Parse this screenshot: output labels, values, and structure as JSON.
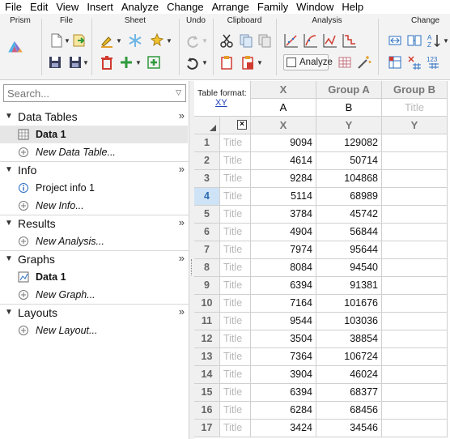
{
  "menu": [
    "File",
    "Edit",
    "View",
    "Insert",
    "Analyze",
    "Change",
    "Arrange",
    "Family",
    "Window",
    "Help"
  ],
  "ribbon": {
    "groups": {
      "prism": "Prism",
      "file": "File",
      "sheet": "Sheet",
      "undo": "Undo",
      "clipboard": "Clipboard",
      "analysis": "Analysis",
      "change": "Change"
    },
    "analyze_label": "Analyze",
    "colors": {
      "accent_red": "#d03a2f",
      "accent_green": "#2f9a3c",
      "accent_blue": "#2b6fc2",
      "accent_orange": "#e4a02a"
    }
  },
  "navigator": {
    "search_placeholder": "Search...",
    "sections": [
      {
        "label": "Data Tables",
        "items": [
          {
            "label": "Data 1",
            "icon": "data-table-icon"
          },
          {
            "label": "New Data Table...",
            "icon": "plus-circle-icon"
          }
        ]
      },
      {
        "label": "Info",
        "items": [
          {
            "label": "Project info 1",
            "icon": "info-icon"
          },
          {
            "label": "New Info...",
            "icon": "plus-circle-icon"
          }
        ]
      },
      {
        "label": "Results",
        "items": [
          {
            "label": "New Analysis...",
            "icon": "plus-circle-icon"
          }
        ]
      },
      {
        "label": "Graphs",
        "items": [
          {
            "label": "Data 1",
            "icon": "graph-icon"
          },
          {
            "label": "New Graph...",
            "icon": "plus-circle-icon"
          }
        ]
      },
      {
        "label": "Layouts",
        "items": [
          {
            "label": "New Layout...",
            "icon": "plus-circle-icon"
          }
        ]
      }
    ]
  },
  "sheet": {
    "table_format_label": "Table format:",
    "table_format_value": "XY",
    "columns": [
      {
        "header": "X",
        "title": "A",
        "sub": "X"
      },
      {
        "header": "Group A",
        "title": "B",
        "sub": "Y"
      },
      {
        "header": "Group B",
        "title": "Title",
        "sub": "Y"
      }
    ],
    "title_placeholder": "Title",
    "current_row": 4,
    "rows": [
      {
        "n": "1",
        "x": "9094",
        "y": "129082"
      },
      {
        "n": "2",
        "x": "4614",
        "y": "50714"
      },
      {
        "n": "3",
        "x": "9284",
        "y": "104868"
      },
      {
        "n": "4",
        "x": "5114",
        "y": "68989"
      },
      {
        "n": "5",
        "x": "3784",
        "y": "45742"
      },
      {
        "n": "6",
        "x": "4904",
        "y": "56844"
      },
      {
        "n": "7",
        "x": "7974",
        "y": "95644"
      },
      {
        "n": "8",
        "x": "8084",
        "y": "94540"
      },
      {
        "n": "9",
        "x": "6394",
        "y": "91381"
      },
      {
        "n": "10",
        "x": "7164",
        "y": "101676"
      },
      {
        "n": "11",
        "x": "9544",
        "y": "103036"
      },
      {
        "n": "12",
        "x": "3504",
        "y": "38854"
      },
      {
        "n": "13",
        "x": "7364",
        "y": "106724"
      },
      {
        "n": "14",
        "x": "3904",
        "y": "46024"
      },
      {
        "n": "15",
        "x": "6394",
        "y": "68377"
      },
      {
        "n": "16",
        "x": "6284",
        "y": "68456"
      },
      {
        "n": "17",
        "x": "3424",
        "y": "34546"
      }
    ]
  }
}
